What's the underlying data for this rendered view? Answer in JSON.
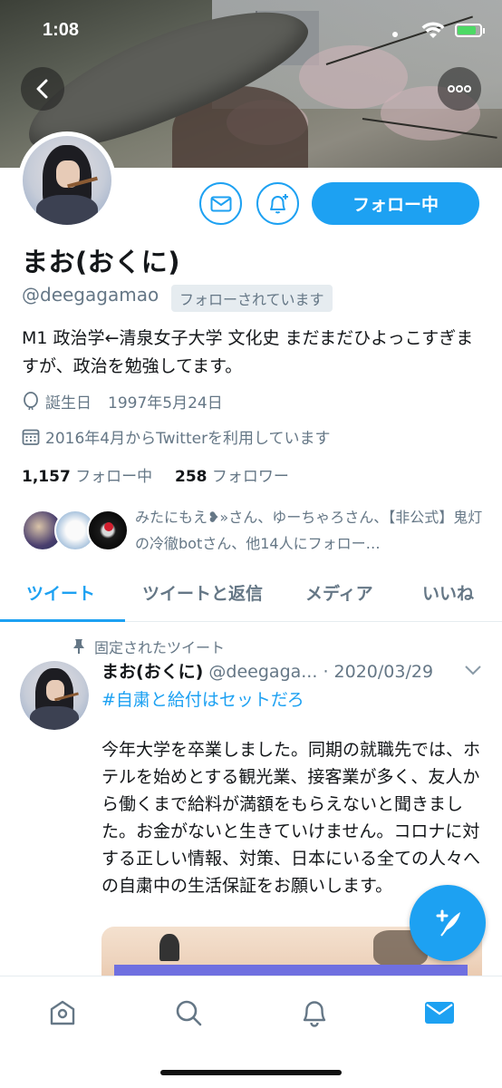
{
  "status_bar": {
    "time": "1:08",
    "battery_level": 0.75
  },
  "profile": {
    "name": "まお(おくに)",
    "handle": "@deegagamao",
    "follows_you_badge": "フォローされています",
    "bio": "M1 政治学←清泉女子大学 文化史 まだまだひよっこすぎますが、政治を勉強してます。",
    "birthday_label": "誕生日",
    "birthday_value": "1997年5月24日",
    "joined": "2016年4月からTwitterを利用しています",
    "following_count": "1,157",
    "following_label": "フォロー中",
    "followers_count": "258",
    "followers_label": "フォロワー",
    "followed_by_text": "みたにもえ❥»さん、ゆーちゃろさん、【非公式】鬼灯の冷徹botさん、他14人にフォロー…"
  },
  "actions": {
    "follow_button": "フォロー中",
    "message_icon": "mail-icon",
    "notify_icon": "bell-plus-icon"
  },
  "tabs": [
    {
      "label": "ツイート",
      "active": true
    },
    {
      "label": "ツイートと返信",
      "active": false
    },
    {
      "label": "メディア",
      "active": false
    },
    {
      "label": "いいね",
      "active": false
    }
  ],
  "tweet": {
    "pinned_label": "固定されたツイート",
    "author_name": "まお(おくに)",
    "author_handle": "@deegaga...",
    "date": "· 2020/03/29",
    "hashtag": "#自粛と給付はセットだろ",
    "body": "今年大学を卒業しました。同期の就職先では、ホテルを始めとする観光業、接客業が多く、友人から働くまで給料が満額をもらえないと聞きました。お金がないと生きていけません。コロナに対する正しい情報、対策、日本にいる全ての人々への自粛中の生活保証をお願いします。"
  },
  "bottom_nav": [
    "home-icon",
    "search-icon",
    "notifications-icon",
    "messages-icon"
  ],
  "colors": {
    "accent": "#1da1f2",
    "secondary_text": "#657786",
    "primary_text": "#14171a"
  }
}
